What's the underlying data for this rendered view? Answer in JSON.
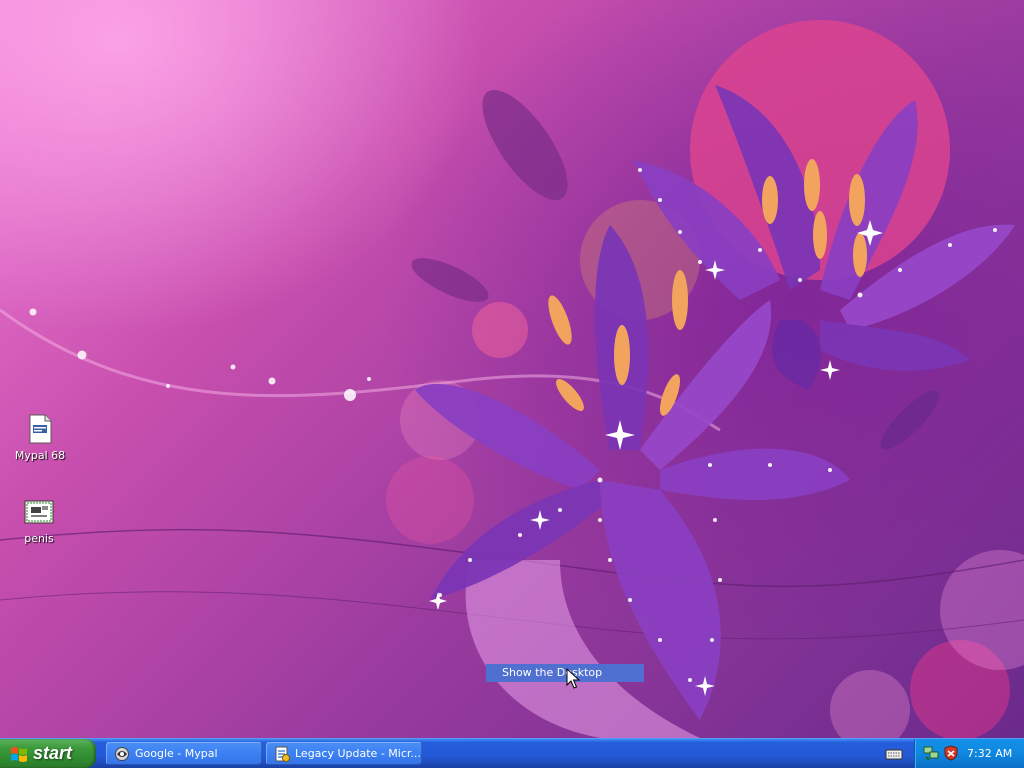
{
  "desktop": {
    "icons": [
      {
        "label": "Mypal 68"
      },
      {
        "label": "penis"
      }
    ],
    "tooltip": "Show the Desktop"
  },
  "taskbar": {
    "start_label": "start",
    "tasks": [
      {
        "label": "Google - Mypal",
        "icon": "mypal-browser-icon"
      },
      {
        "label": "Legacy Update - Micr...",
        "icon": "legacy-update-icon"
      }
    ],
    "tray": {
      "clock": "7:32 AM"
    }
  },
  "colors": {
    "taskbar_blue": "#245edb",
    "start_green": "#3c9a3c",
    "tray_blue": "#0f87e0",
    "tooltip_blue": "#4f6fd1"
  }
}
